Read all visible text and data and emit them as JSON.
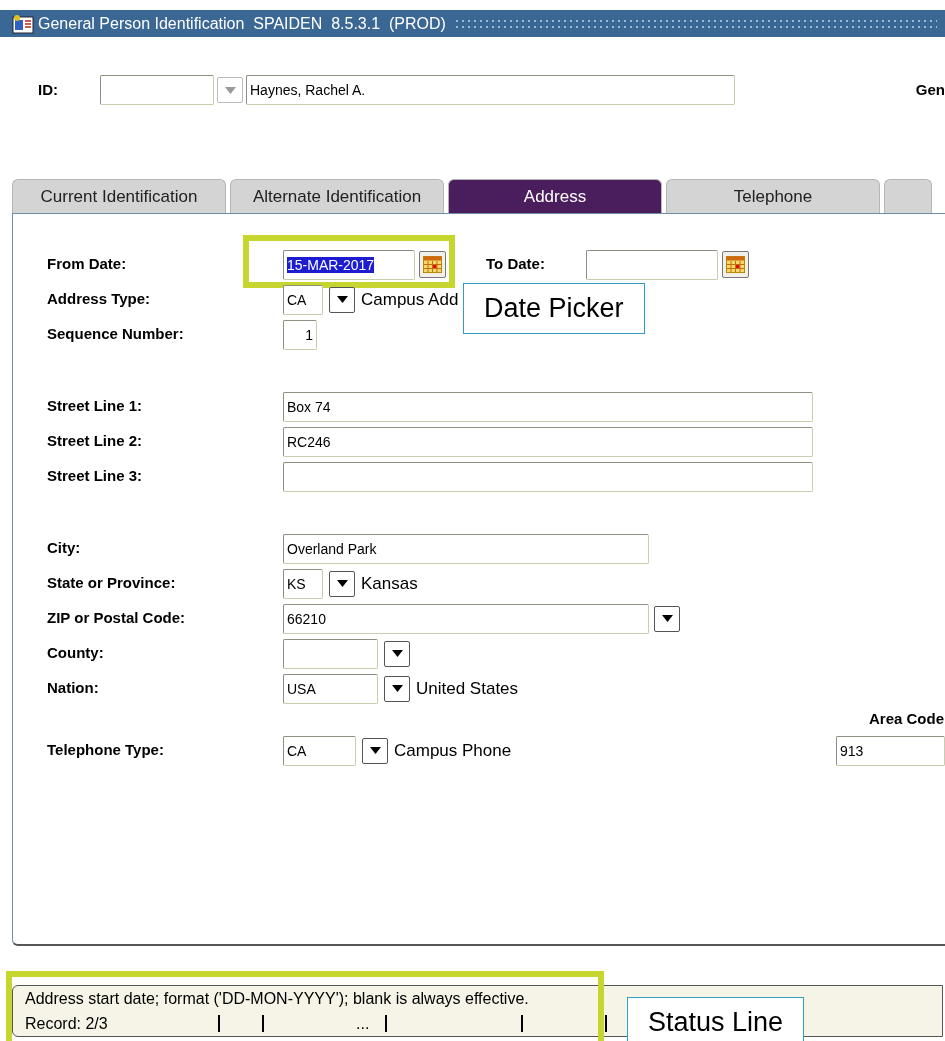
{
  "window": {
    "title": "General Person Identification  SPAIDEN  8.5.3.1  (PROD)"
  },
  "header": {
    "id_label": "ID:",
    "name": "Haynes, Rachel A.",
    "right_label": "Gen",
    "dropdown_disabled": true
  },
  "tabs": [
    {
      "label": "Current Identification",
      "selected": false
    },
    {
      "label": "Alternate Identification",
      "selected": false
    },
    {
      "label": "Address",
      "selected": true
    },
    {
      "label": "Telephone",
      "selected": false
    }
  ],
  "groups": [
    [
      {
        "kind": "date",
        "label": "From Date:",
        "value": "15-MAR-2017",
        "text_selected": true,
        "second": {
          "label": "To Date:"
        }
      },
      {
        "kind": "code",
        "label": "Address Type:",
        "value": "CA",
        "dropdown": true,
        "description": "Campus Add"
      },
      {
        "kind": "number",
        "label": "Sequence Number:",
        "value": "1"
      }
    ],
    [
      {
        "kind": "line",
        "label": "Street Line 1:",
        "value": "Box 74"
      },
      {
        "kind": "line",
        "label": "Street Line 2:",
        "value": "RC246"
      },
      {
        "kind": "line",
        "label": "Street Line 3:"
      }
    ],
    [
      {
        "kind": "text",
        "label": "City:",
        "value": "Overland Park"
      },
      {
        "kind": "code",
        "label": "State or Province:",
        "value": "KS",
        "dropdown": true,
        "description": "Kansas"
      },
      {
        "kind": "text",
        "label": "ZIP or Postal Code:",
        "value": "66210",
        "dropdown": true
      },
      {
        "kind": "wide-code",
        "label": "County:",
        "dropdown": true
      },
      {
        "kind": "wide-code",
        "label": "Nation:",
        "value": "USA",
        "dropdown": true,
        "description": "United States"
      },
      {
        "kind": "heading",
        "label": "Area Code"
      },
      {
        "kind": "phone",
        "label": "Telephone Type:",
        "value": "CA",
        "dropdown": true,
        "description": "Campus Phone",
        "area_code": "913"
      }
    ]
  ],
  "status_bar": {
    "message": "Address start date; format ('DD-MON-YYYY'); blank is always effective.",
    "record": "Record: 2/3",
    "segment": "..."
  },
  "callouts": [
    {
      "kind": "date-picker",
      "text": "Date Picker"
    },
    {
      "kind": "status-line",
      "text": "Status Line"
    }
  ]
}
